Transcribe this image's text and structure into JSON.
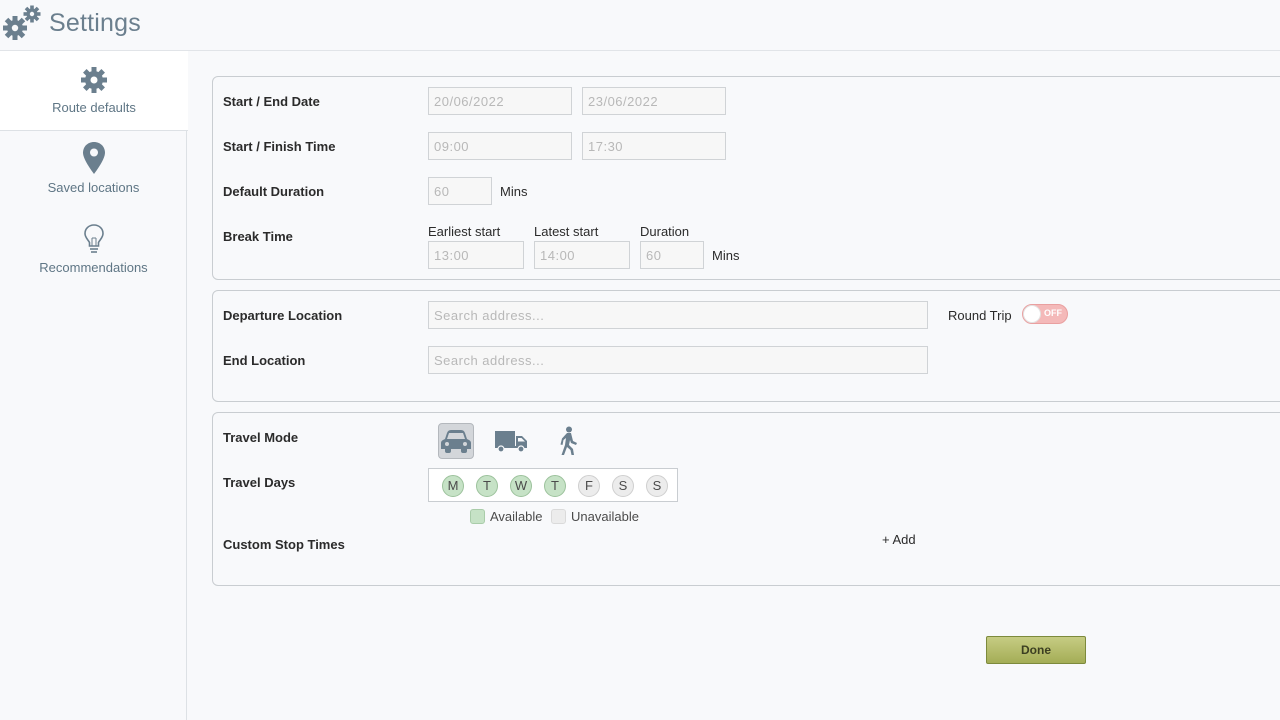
{
  "header": {
    "title": "Settings"
  },
  "sidebar": {
    "items": [
      {
        "label": "Route defaults",
        "icon": "gear-icon",
        "active": true
      },
      {
        "label": "Saved locations",
        "icon": "map-pin-icon",
        "active": false
      },
      {
        "label": "Recommendations",
        "icon": "lightbulb-icon",
        "active": false
      }
    ]
  },
  "schedule": {
    "start_end_date_label": "Start / End Date",
    "start_date_placeholder": "20/06/2022",
    "end_date_placeholder": "23/06/2022",
    "start_finish_time_label": "Start / Finish Time",
    "start_time_placeholder": "09:00",
    "finish_time_placeholder": "17:30",
    "default_duration_label": "Default Duration",
    "default_duration_placeholder": "60",
    "default_duration_unit": "Mins",
    "break_time_label": "Break Time",
    "break_earliest_label": "Earliest start",
    "break_latest_label": "Latest start",
    "break_duration_label": "Duration",
    "break_earliest_placeholder": "13:00",
    "break_latest_placeholder": "14:00",
    "break_duration_placeholder": "60",
    "break_duration_unit": "Mins"
  },
  "locations": {
    "departure_label": "Departure Location",
    "departure_placeholder": "Search address...",
    "end_label": "End Location",
    "end_placeholder": "Search address...",
    "round_trip_label": "Round Trip",
    "round_trip_state": "OFF"
  },
  "travel": {
    "mode_label": "Travel Mode",
    "modes": [
      {
        "icon": "car-icon",
        "active": true
      },
      {
        "icon": "truck-icon",
        "active": false
      },
      {
        "icon": "walking-person-icon",
        "active": false
      }
    ],
    "days_label": "Travel Days",
    "days": [
      {
        "letter": "M",
        "available": true
      },
      {
        "letter": "T",
        "available": true
      },
      {
        "letter": "W",
        "available": true
      },
      {
        "letter": "T",
        "available": true
      },
      {
        "letter": "F",
        "available": false
      },
      {
        "letter": "S",
        "available": false
      },
      {
        "letter": "S",
        "available": false
      }
    ],
    "legend_available": "Available",
    "legend_unavailable": "Unavailable",
    "custom_stop_label": "Custom Stop Times",
    "add_label": "+ Add"
  },
  "colors": {
    "available": "#c6e2c6",
    "unavailable": "#ececec",
    "toggle_off": "#f4b9b9",
    "done_button": "#b5bd6b"
  },
  "footer": {
    "done_label": "Done"
  }
}
